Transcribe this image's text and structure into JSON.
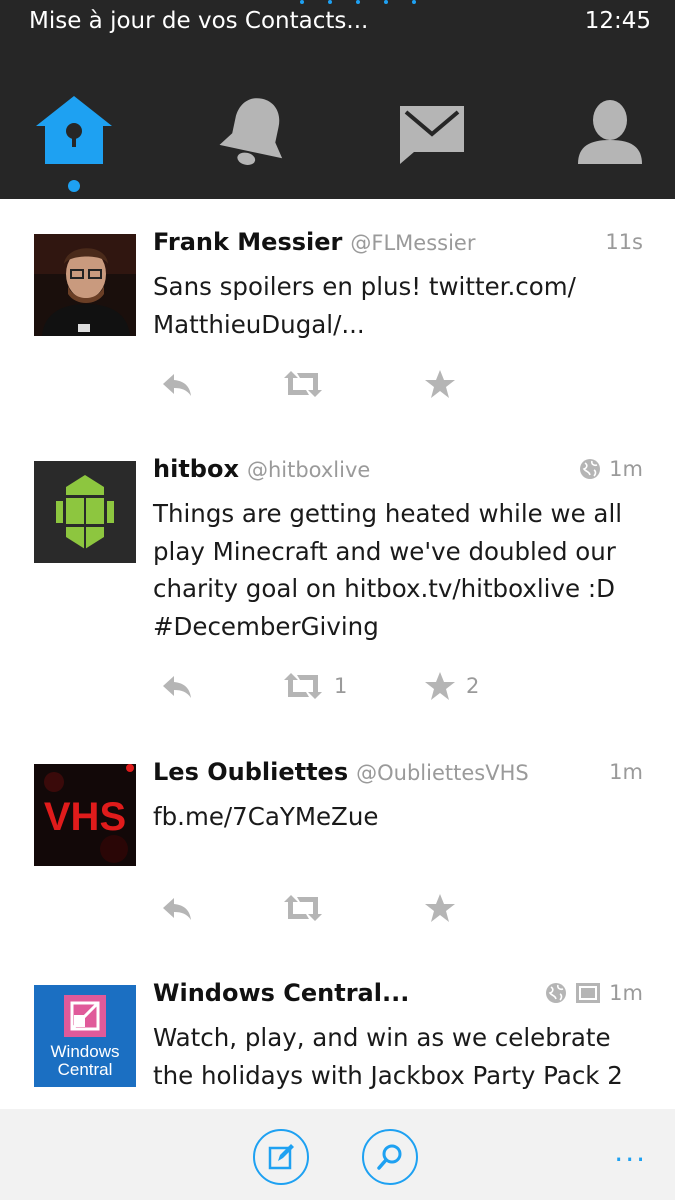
{
  "status_bar": {
    "message": "Mise à jour de vos Contacts...",
    "time": "12:45"
  },
  "nav": {
    "items": [
      {
        "icon": "home-icon",
        "active": true
      },
      {
        "icon": "bell-icon",
        "active": false
      },
      {
        "icon": "envelope-icon",
        "active": false
      },
      {
        "icon": "person-icon",
        "active": false
      }
    ],
    "accent_color": "#1ea1f2",
    "inactive_color": "#b5b5b5"
  },
  "tweets": [
    {
      "name": "Frank Messier",
      "handle": "@FLMessier",
      "time": "11s",
      "lines": [
        "Sans spoilers en plus! twitter.com/",
        "MatthieuDugal/..."
      ],
      "retweets": "",
      "favorites": ""
    },
    {
      "name": "hitbox",
      "handle": "@hitboxlive",
      "time": "1m",
      "globe": true,
      "lines": [
        "Things are getting heated while we all",
        "play Minecraft and we've doubled our",
        "charity goal on hitbox.tv/hitboxlive :D",
        "#DecemberGiving"
      ],
      "retweets": "1",
      "favorites": "2"
    },
    {
      "name": "Les Oubliettes",
      "handle": "@OubliettesVHS",
      "time": "1m",
      "avatar_text": "VHS",
      "lines": [
        "fb.me/7CaYMeZue"
      ],
      "retweets": "",
      "favorites": ""
    },
    {
      "name": "Windows Central...",
      "handle": "",
      "time": "1m",
      "globe": true,
      "media": true,
      "avatar_text_1": "Windows",
      "avatar_text_2": "Central",
      "lines": [
        "Watch, play, and win as we celebrate",
        "the holidays with Jackbox Party Pack 2"
      ],
      "retweets": "",
      "favorites": ""
    }
  ],
  "app_bar": {
    "more_label": "..."
  }
}
